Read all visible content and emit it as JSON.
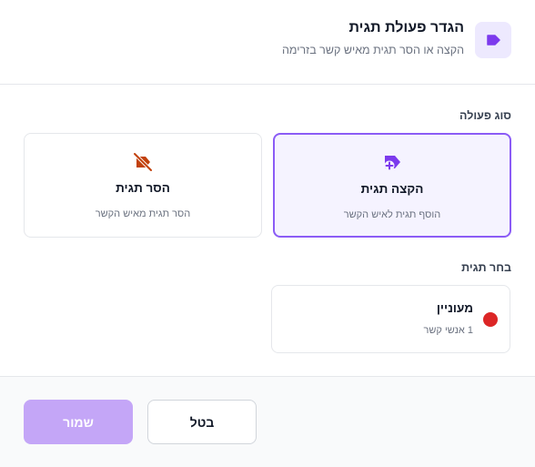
{
  "header": {
    "title": "הגדר פעולת תגית",
    "subtitle": "הקצה או הסר תגית מאיש קשר בזרימה",
    "icon": "tag-icon",
    "accent_color": "#7c3aed"
  },
  "action_type": {
    "label": "סוג פעולה",
    "options": [
      {
        "title": "הקצה תגית",
        "description": "הוסף תגית לאיש הקשר",
        "icon": "tag-plus-icon",
        "selected": true
      },
      {
        "title": "הסר תגית",
        "description": "הסר תגית מאיש הקשר",
        "icon": "tag-off-icon",
        "selected": false
      }
    ]
  },
  "tag_select": {
    "label": "בחר תגית",
    "tags": [
      {
        "name": "מעוניין",
        "count_text": "1 אנשי קשר",
        "color": "#dc2626"
      }
    ]
  },
  "footer": {
    "save_label": "שמור",
    "cancel_label": "בטל"
  }
}
